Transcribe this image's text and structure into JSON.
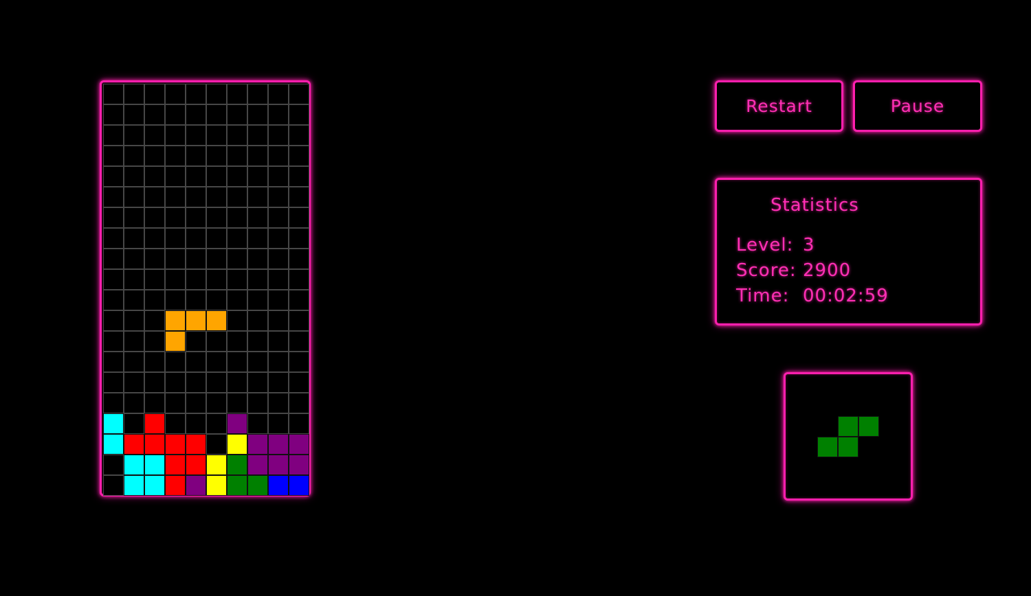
{
  "buttons": {
    "restart_label": "Restart",
    "pause_label": "Pause"
  },
  "statistics": {
    "title": "Statistics",
    "level_label": "Level:",
    "level_value": "3",
    "score_label": "Score:",
    "score_value": "2900",
    "time_label": "Time:",
    "time_value": "00:02:59"
  },
  "colors": {
    "neon": "#ff1fae",
    "grid_line": "#474747",
    "I": "#00ffff",
    "Z": "#ff0000",
    "T": "#800080",
    "O": "#ffff00",
    "S": "#008000",
    "J": "#0000ff",
    "L": "#ffa500"
  },
  "board": {
    "columns": 10,
    "rows": 20,
    "cells": [
      "..........",
      "..........",
      "..........",
      "..........",
      "..........",
      "..........",
      "..........",
      "..........",
      "..........",
      "..........",
      "..........",
      "...LLL....",
      "...L......",
      "..........",
      "..........",
      "..........",
      "I.Z...T...",
      "IZZZZ.OTTT",
      ".IIZZOSTTT",
      ".IIZTOSSJJ"
    ]
  },
  "next_piece": {
    "type": "S",
    "cells": [
      ".SS",
      "SS."
    ]
  }
}
